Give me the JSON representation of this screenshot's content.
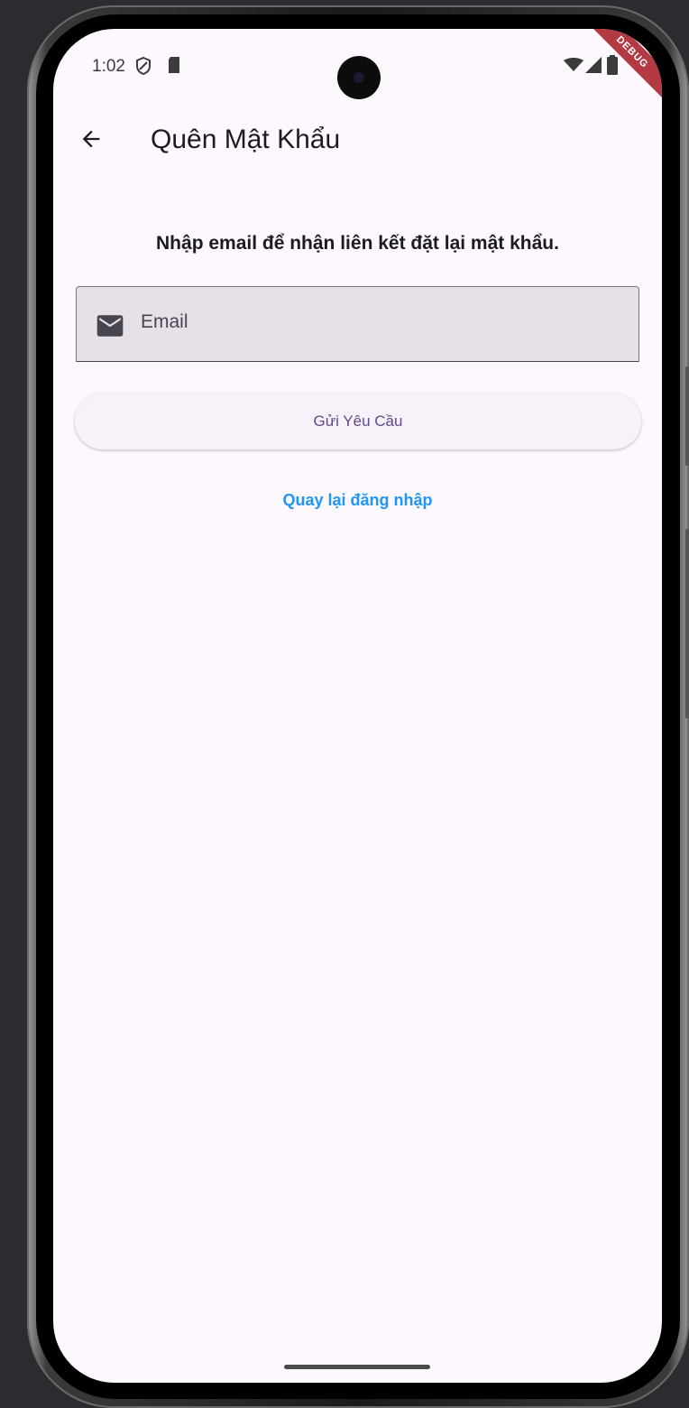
{
  "status_bar": {
    "time": "1:02",
    "icons": [
      "shield-icon",
      "sd-card-icon",
      "wifi-icon",
      "signal-icon",
      "battery-icon"
    ]
  },
  "debug_banner": "DEBUG",
  "app_bar": {
    "back_icon": "arrow-back-icon",
    "title": "Quên Mật Khẩu"
  },
  "form": {
    "instruction": "Nhập email để nhận liên kết đặt lại mật khẩu.",
    "email_icon": "mail-icon",
    "email_placeholder": "Email",
    "email_value": ""
  },
  "actions": {
    "submit_label": "Gửi Yêu Cầu",
    "back_to_login_label": "Quay lại đăng nhập"
  },
  "colors": {
    "background": "#fdf7fe",
    "field_fill": "#e6e0e9",
    "button_text": "#5e4a8c",
    "link": "#2196f3"
  }
}
